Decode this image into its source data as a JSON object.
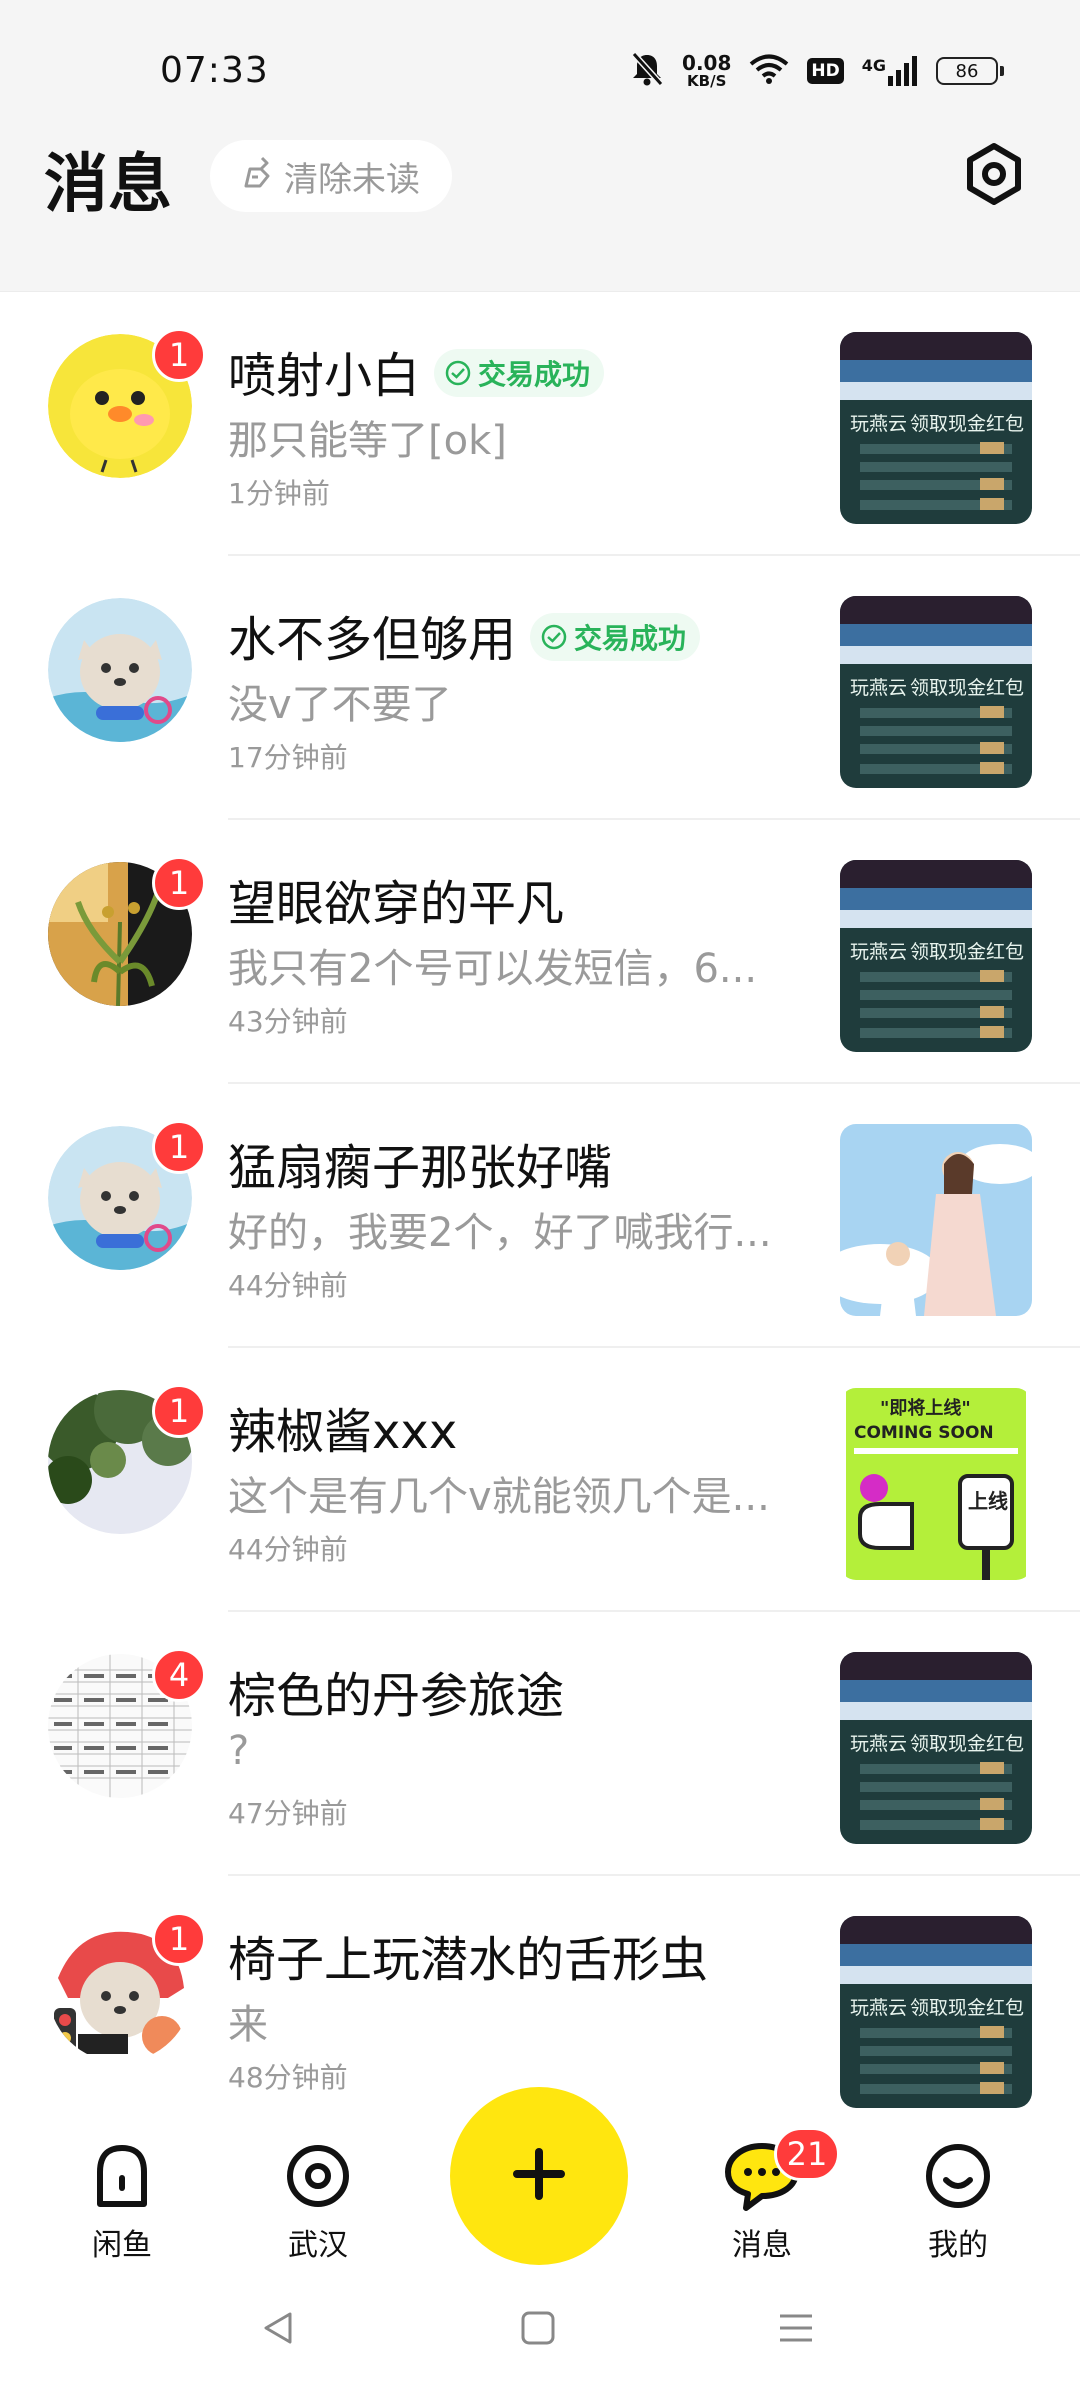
{
  "status_bar": {
    "time": "07:33",
    "net_speed_value": "0.08",
    "net_speed_unit": "KB/S",
    "hd_label": "HD",
    "network_label": "4G",
    "battery_level": "86"
  },
  "header": {
    "title": "消息",
    "clear_unread_label": "清除未读",
    "settings_icon": "settings-hexagon-icon"
  },
  "messages": [
    {
      "name": "喷射小白",
      "tag": "交易成功",
      "preview": "那只能等了[ok]",
      "time": "1分钟前",
      "badge": "1"
    },
    {
      "name": "水不多但够用",
      "tag": "交易成功",
      "preview": "没v了不要了",
      "time": "17分钟前",
      "badge": ""
    },
    {
      "name": "望眼欲穿的平凡",
      "tag": "",
      "preview": "我只有2个号可以发短信，6...",
      "time": "43分钟前",
      "badge": "1"
    },
    {
      "name": "猛扇瘸子那张好嘴",
      "tag": "",
      "preview": "好的，我要2个，好了喊我行...",
      "time": "44分钟前",
      "badge": "1"
    },
    {
      "name": "辣椒酱xxx",
      "tag": "",
      "preview": "这个是有几个v就能领几个是...",
      "time": "44分钟前",
      "badge": "1"
    },
    {
      "name": "棕色的丹参旅途",
      "tag": "",
      "preview": "?",
      "time": "47分钟前",
      "badge": "4"
    },
    {
      "name": "椅子上玩潜水的舌形虫",
      "tag": "",
      "preview": "来",
      "time": "48分钟前",
      "badge": "1"
    }
  ],
  "thumbs": {
    "banner_line1": "玩燕云",
    "banner_line2": "领取现金红包",
    "coming_top": "\"即将上线\"",
    "coming_main": "COMING SOON",
    "coming_sign": "上线"
  },
  "tab_bar": {
    "tabs": [
      {
        "label": "闲鱼",
        "icon": "home-icon"
      },
      {
        "label": "武汉",
        "icon": "location-icon"
      },
      {
        "label": "消息",
        "icon": "message-bubble-icon"
      },
      {
        "label": "我的",
        "icon": "profile-smile-icon"
      }
    ],
    "fab_icon": "plus-icon",
    "messages_badge": "21"
  },
  "colors": {
    "accent_yellow": "#ffe60f",
    "badge_red": "#ff3b3b",
    "success_green": "#29b35a"
  }
}
